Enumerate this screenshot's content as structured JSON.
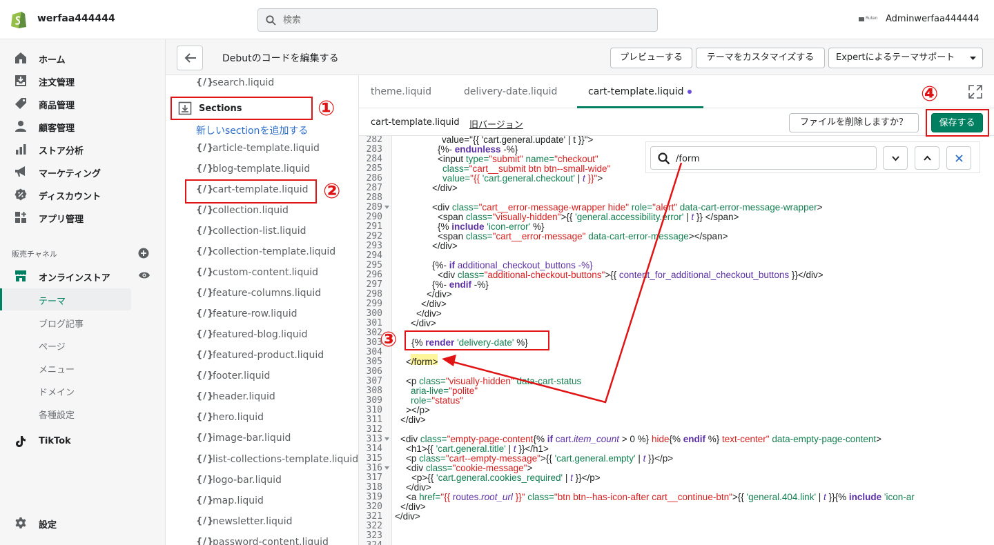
{
  "topbar": {
    "store_name": "werfaa444444",
    "search_placeholder": "検索",
    "ruten_text": "Ruten",
    "admin_name": "Adminwerfaa444444"
  },
  "sidebar": {
    "items": [
      {
        "label": "ホーム",
        "icon": "home-icon"
      },
      {
        "label": "注文管理",
        "icon": "inbox-download-icon"
      },
      {
        "label": "商品管理",
        "icon": "tag-icon"
      },
      {
        "label": "顧客管理",
        "icon": "person-icon"
      },
      {
        "label": "ストア分析",
        "icon": "bar-chart-icon"
      },
      {
        "label": "マーケティング",
        "icon": "megaphone-icon"
      },
      {
        "label": "ディスカウント",
        "icon": "discount-badge-icon"
      },
      {
        "label": "アプリ管理",
        "icon": "apps-grid-icon"
      }
    ],
    "channel_title": "販売チャネル",
    "online_store": "オンラインストア",
    "sub_items": [
      "テーマ",
      "ブログ記事",
      "ページ",
      "メニュー",
      "ドメイン",
      "各種設定"
    ],
    "tiktok": "TikTok",
    "settings": "設定"
  },
  "editor": {
    "title": "Debutのコードを編集する",
    "preview_label": "プレビューする",
    "customize_label": "テーマをカスタマイズする",
    "expert_label": "Expertによるテーマサポート"
  },
  "files": {
    "search_file": "search.liquid",
    "folder_label": "Sections",
    "add_section": "新しいsectionを追加する",
    "code_badge": "{/}",
    "items": [
      "article-template.liquid",
      "blog-template.liquid",
      "cart-template.liquid",
      "collection.liquid",
      "collection-list.liquid",
      "collection-template.liquid",
      "custom-content.liquid",
      "feature-columns.liquid",
      "feature-row.liquid",
      "featured-blog.liquid",
      "featured-product.liquid",
      "footer.liquid",
      "header.liquid",
      "hero.liquid",
      "image-bar.liquid",
      "list-collections-template.liquid",
      "logo-bar.liquid",
      "map.liquid",
      "newsletter.liquid",
      "password-content.liquid"
    ]
  },
  "tabs": [
    "theme.liquid",
    "delivery-date.liquid",
    "cart-template.liquid"
  ],
  "filebar": {
    "name": "cart-template.liquid",
    "old_version": "旧バージョン",
    "delete_label": "ファイルを削除しますか？",
    "save_label": "保存する"
  },
  "find": {
    "value": "/form"
  },
  "annotations": [
    "①",
    "②",
    "③",
    "④"
  ],
  "code": {
    "line_numbers": [
      "282",
      "283",
      "284",
      "285",
      "286",
      "287",
      "288",
      "289",
      "290",
      "291",
      "292",
      "293",
      "294",
      "295",
      "296",
      "297",
      "298",
      "299",
      "300",
      "301",
      "302",
      "303",
      "304",
      "305",
      "306",
      "307",
      "308",
      "309",
      "310",
      "311",
      "312",
      "313",
      "314",
      "315",
      "316",
      "317",
      "318",
      "319",
      "320",
      "321",
      "322",
      "323",
      "324"
    ],
    "texts": {
      "l282": "value=\"{{ 'cart.general.update' | t }}\">",
      "l283a": "{%- ",
      "l283b": "endunless",
      "l283c": " -%}",
      "l284a": "<input ",
      "l284b": "type=",
      "l284c": "\"submit\"",
      "l284d": " name=",
      "l284e": "\"checkout\"",
      "l285a": "class=",
      "l285b": "\"cart__submit btn btn--small-wide\"",
      "l286a": "value=",
      "l286b": "\"{{ ",
      "l286c": "'cart.general.checkout'",
      "l286d": " | ",
      "l286e": "t",
      "l286f": " }}\"",
      "l286g": ">",
      "l287": "</div>",
      "l289a": "<div ",
      "l289b": "class=",
      "l289c": "\"cart__error-message-wrapper hide\"",
      "l289d": " role=",
      "l289e": "\"alert\"",
      "l289f": " data-cart-error-message-wrapper",
      "l289g": ">",
      "l290a": "<span ",
      "l290b": "class=",
      "l290c": "\"visually-hidden\"",
      "l290d": ">{{ ",
      "l290e": "'general.accessibility.error'",
      "l290f": " | ",
      "l290g": "t",
      "l290h": " }} </span>",
      "l291a": "{% ",
      "l291b": "include",
      "l291c": " ",
      "l291d": "'icon-error'",
      "l291e": " %}",
      "l292a": "<span ",
      "l292b": "class=",
      "l292c": "\"cart__error-message\"",
      "l292d": " data-cart-error-message",
      "l292e": "></span>",
      "l293": "</div>",
      "l295a": "{%- ",
      "l295b": "if",
      "l295c": " additional_checkout_buttons -%}",
      "l296a": "<div ",
      "l296b": "class=",
      "l296c": "\"additional-checkout-buttons\"",
      "l296d": ">{{ ",
      "l296e": "content_for_additional_checkout_buttons",
      "l296f": " }}</div>",
      "l297a": "{%- ",
      "l297b": "endif",
      "l297c": " -%}",
      "l298": "</div>",
      "l299": "</div>",
      "l300": "</div>",
      "l301": "</div>",
      "l303a": "{% ",
      "l303b": "render",
      "l303c": " ",
      "l303d": "'delivery-date'",
      "l303e": " %}",
      "l305a": "<",
      "l305b": "/form",
      "l305c": ">",
      "l307a": "<p ",
      "l307b": "class=",
      "l307c": "\"visually-hidden\"",
      "l307d": " data-cart-status",
      "l308a": "aria-live=",
      "l308b": "\"polite\"",
      "l309a": "role=",
      "l309b": "\"status\"",
      "l310": "></p>",
      "l311": "</div>",
      "l313a": "<div ",
      "l313b": "class=",
      "l313c": "\"empty-page-content",
      "l313d": "{% ",
      "l313e": "if",
      "l313f": " cart.",
      "l313g": "item_count",
      "l313h": " > ",
      "l313i": "0",
      "l313j": " %}",
      "l313k": " hide",
      "l313l": "{% ",
      "l313m": "endif",
      "l313n": " %}",
      "l313o": " text-center\"",
      "l313p": " data-empty-page-content",
      "l313q": ">",
      "l314a": "<h1>{{ ",
      "l314b": "'cart.general.title'",
      "l314c": " | ",
      "l314d": "t",
      "l314e": " }}</h1>",
      "l315a": "<p ",
      "l315b": "class=",
      "l315c": "\"cart--empty-message\"",
      "l315d": ">{{ ",
      "l315e": "'cart.general.empty'",
      "l315f": " | ",
      "l315g": "t",
      "l315h": " }}</p>",
      "l316a": "<div ",
      "l316b": "class=",
      "l316c": "\"cookie-message\"",
      "l316d": ">",
      "l317a": "<p>{{ ",
      "l317b": "'cart.general.cookies_required'",
      "l317c": " | ",
      "l317d": "t",
      "l317e": " }}</p>",
      "l318": "</div>",
      "l319a": "<a ",
      "l319b": "href=",
      "l319c": "\"{{ ",
      "l319d": "routes.",
      "l319e": "root_url",
      "l319f": " }}\"",
      "l319g": " class=",
      "l319h": "\"btn btn--has-icon-after cart__continue-btn\"",
      "l319i": ">{{ ",
      "l319j": "'general.404.link'",
      "l319k": " | ",
      "l319l": "t",
      "l319m": " }}{% ",
      "l319n": "include",
      "l319o": " ",
      "l319p": "'icon-ar",
      "l320": "</div>",
      "l321": "</div>"
    }
  },
  "colors": {
    "accent": "#008060",
    "annotation": "#e01414",
    "link": "#2c6ecb",
    "find_highlight": "#fff59a"
  }
}
